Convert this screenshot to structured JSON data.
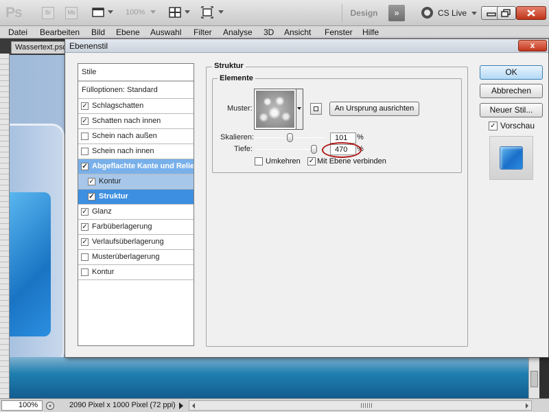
{
  "app": {
    "logo": "Ps",
    "bridge_label": "Br",
    "minibridge_label": "Mb",
    "zoom": "100%",
    "workspace": "Design",
    "more": "»",
    "cslive": "CS Live"
  },
  "menu": [
    "Datei",
    "Bearbeiten",
    "Bild",
    "Ebene",
    "Auswahl",
    "Filter",
    "Analyse",
    "3D",
    "Ansicht",
    "Fenster",
    "Hilfe"
  ],
  "document": {
    "tab": "Wassertext.psd",
    "zoom": "100%",
    "info": "2090 Pixel x 1000 Pixel (72 ppi)"
  },
  "dialog": {
    "title": "Ebenenstil",
    "close": "x",
    "styles_header": "Stile",
    "fill_options": "Fülloptionen: Standard",
    "styles": [
      {
        "label": "Schlagschatten",
        "checked": true
      },
      {
        "label": "Schatten nach innen",
        "checked": true
      },
      {
        "label": "Schein nach außen",
        "checked": false
      },
      {
        "label": "Schein nach innen",
        "checked": false
      },
      {
        "label": "Abgeflachte Kante und Relief",
        "checked": true
      },
      {
        "label": "Kontur",
        "checked": true
      },
      {
        "label": "Struktur",
        "checked": true
      },
      {
        "label": "Glanz",
        "checked": true
      },
      {
        "label": "Farbüberlagerung",
        "checked": true
      },
      {
        "label": "Verlaufsüberlagerung",
        "checked": true
      },
      {
        "label": "Musterüberlagerung",
        "checked": false
      },
      {
        "label": "Kontur",
        "checked": false
      }
    ],
    "section_title": "Struktur",
    "subsection_title": "Elemente",
    "pattern_label": "Muster:",
    "origin_button": "An Ursprung ausrichten",
    "scale_label": "Skalieren:",
    "scale_value": "101",
    "scale_unit": "%",
    "scale_fraction": 0.101,
    "depth_label": "Tiefe:",
    "depth_value": "470",
    "depth_unit": "%",
    "depth_fraction": 0.94,
    "invert_label": "Umkehren",
    "invert_checked": false,
    "link_label": "Mit Ebene verbinden",
    "link_checked": true,
    "ok": "OK",
    "cancel": "Abbrechen",
    "new_style": "Neuer Stil...",
    "preview_label": "Vorschau",
    "preview_checked": true
  }
}
